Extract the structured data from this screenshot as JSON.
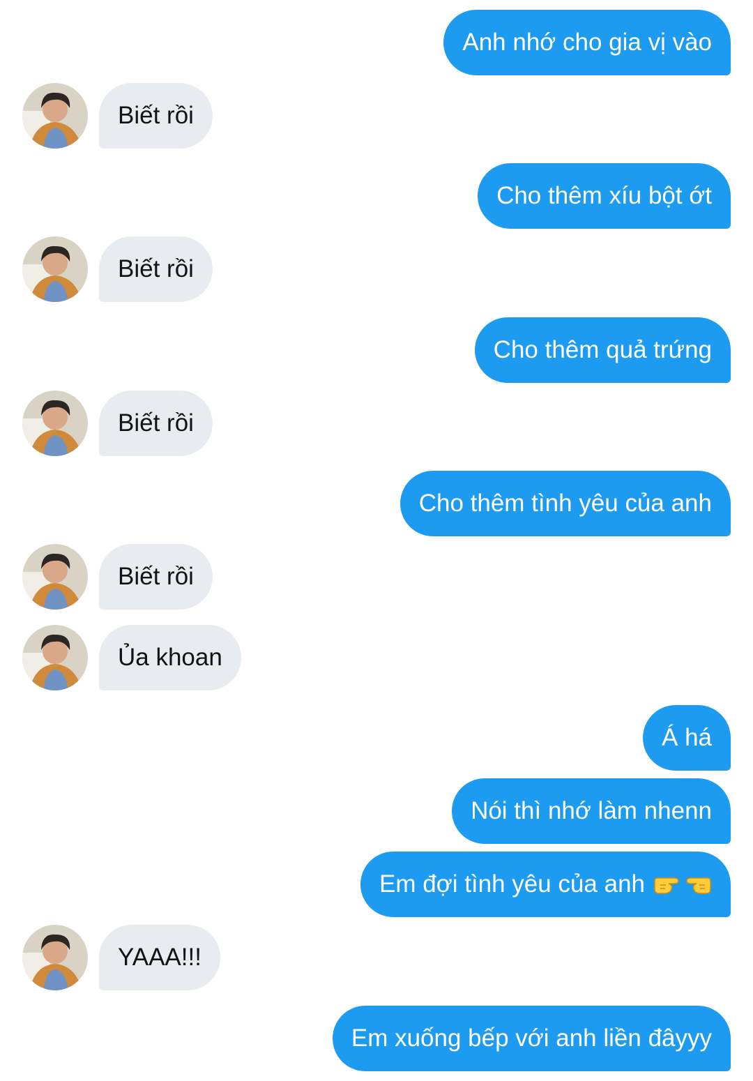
{
  "conversation": {
    "messages": [
      {
        "side": "sent",
        "text": "Anh nhớ cho gia vị vào"
      },
      {
        "side": "recv",
        "text": "Biết rồi"
      },
      {
        "side": "sent",
        "text": "Cho thêm xíu bột ớt"
      },
      {
        "side": "recv",
        "text": "Biết rồi"
      },
      {
        "side": "sent",
        "text": "Cho thêm quả trứng"
      },
      {
        "side": "recv",
        "text": "Biết rồi"
      },
      {
        "side": "sent",
        "text": "Cho thêm tình yêu của anh"
      },
      {
        "side": "recv",
        "text": "Biết rồi"
      },
      {
        "side": "recv",
        "text": "Ủa khoan"
      },
      {
        "side": "sent",
        "text": "Á há"
      },
      {
        "side": "sent",
        "text": "Nói thì nhớ làm nhenn"
      },
      {
        "side": "sent",
        "text": "Em đợi tình yêu của anh",
        "emoji": [
          "pointing-right-hand",
          "pointing-left-hand"
        ]
      },
      {
        "side": "recv",
        "text": "YAAA!!!"
      },
      {
        "side": "sent",
        "text": "Em xuống bếp với anh liền đâyyy"
      }
    ]
  },
  "colors": {
    "sent_bubble": "#1d9bf0",
    "recv_bubble": "#e8ecf0",
    "sent_text": "#ffffff",
    "recv_text": "#0f1419"
  }
}
